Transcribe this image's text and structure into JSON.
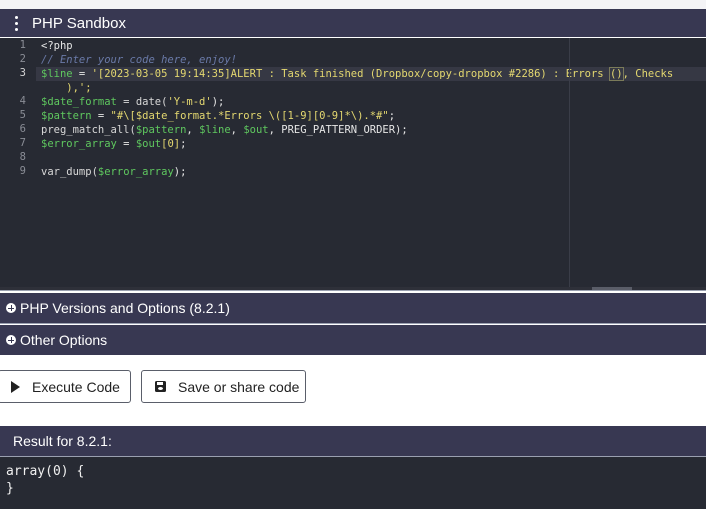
{
  "header": {
    "title": "PHP Sandbox",
    "menu_icon": "kebab-menu-icon"
  },
  "editor": {
    "line_numbers": [
      "1",
      "2",
      "3",
      "4",
      "5",
      "6",
      "7",
      "8",
      "9"
    ],
    "active_line": "3",
    "lines": {
      "l1": "<?php",
      "l2": "// Enter your code here, enjoy!",
      "l3_var": "$line",
      "l3_op": " = ",
      "l3_str": "'[2023-03-05 19:14:35]ALERT : Task finished (Dropbox/copy-dropbox #2286) : Errors ",
      "l3_brk": "()",
      "l3_tail": ", Checks",
      "l3_wrap": "    ),';",
      "l4_var": "$date_format",
      "l4_mid": " = date(",
      "l4_str": "'Y-m-d'",
      "l4_end": ");",
      "l5_var": "$pattern",
      "l5_op": " = ",
      "l5_str": "\"#\\[$date_format.*Errors \\([1-9][0-9]*\\).*#\"",
      "l5_end": ";",
      "l6_fn": "preg_match_all(",
      "l6_v1": "$pattern",
      "l6_c1": ", ",
      "l6_v2": "$line",
      "l6_c2": ", ",
      "l6_v3": "$out",
      "l6_end": ", PREG_PATTERN_ORDER);",
      "l7_var": "$error_array",
      "l7_op": " = ",
      "l7_v2": "$out",
      "l7_idx": "[0]",
      "l7_end": ";",
      "l9_fn": "var_dump(",
      "l9_var": "$error_array",
      "l9_end": ");"
    }
  },
  "panels": {
    "versions": "PHP Versions and Options (8.2.1)",
    "other": "Other Options"
  },
  "buttons": {
    "execute": "Execute Code",
    "save": "Save or share code"
  },
  "result": {
    "heading": "Result for 8.2.1:",
    "output": "array(0) {\n}"
  },
  "colors": {
    "header_bg": "#383852",
    "editor_bg": "#272a33",
    "variable": "#5fc85f",
    "string": "#e4d870",
    "comment": "#6a7aa8"
  }
}
